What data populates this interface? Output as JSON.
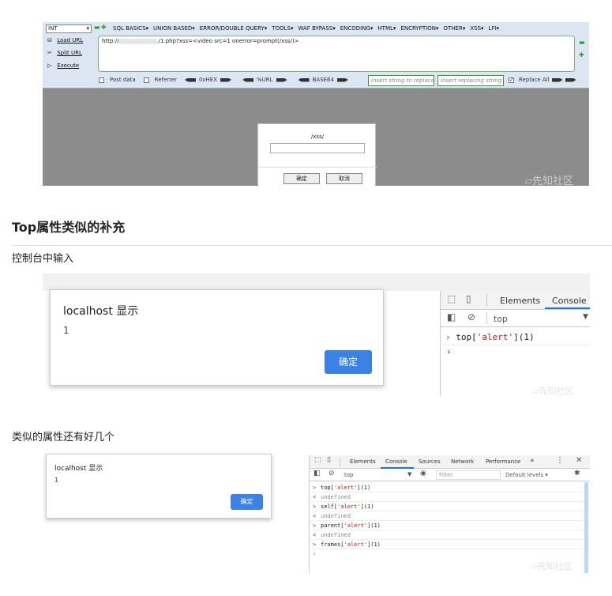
{
  "hackbar": {
    "select_value": "INT",
    "menu": [
      "SQL BASICS▾",
      "UNION BASED▾",
      "ERROR/DOUBLE QUERY▾",
      "TOOLS▾",
      "WAF BYPASS▾",
      "ENCODING▾",
      "HTML▾",
      "ENCRYPTION▾",
      "OTHER▾",
      "XSS▾",
      "LFI▾"
    ],
    "load_url": "Load URL",
    "split_url": "Split URL",
    "execute": "Execute",
    "url_prefix": "http://",
    "url_rest": "./1.php?xss=<video src=1 onerror=prompt(/xss/)>",
    "post_data": "Post data",
    "referrer": "Referrer",
    "hex": "0xHEX",
    "url_enc": "%URL",
    "base64": "BASE64",
    "insert_placeholder": "Insert string to replace",
    "replacing_placeholder": "Insert replacing string",
    "replace_all": "Replace All",
    "prompt_text": "/xss/",
    "ok": "确定",
    "cancel": "取消",
    "watermark": "先知社区"
  },
  "heading": "Top属性类似的补充",
  "para1": "控制台中输入",
  "shot2": {
    "alert_title": "localhost 显示",
    "alert_msg": "1",
    "ok": "确定",
    "tab_elements": "Elements",
    "tab_console": "Console",
    "context": "top",
    "prompt_code_a": "top[",
    "prompt_code_b": "'alert'",
    "prompt_code_c": "](1)",
    "watermark": "先知社区"
  },
  "para2": "类似的属性还有好几个",
  "shot3": {
    "alert_title": "localhost 显示",
    "alert_msg": "1",
    "ok": "确定",
    "tabs": [
      "Elements",
      "Console",
      "Sources",
      "Network",
      "Performance",
      "»"
    ],
    "context": "top",
    "filter": "Filter",
    "levels": "Default levels ▾",
    "lines": [
      {
        "p": ">",
        "a": "top[",
        "s": "'alert'",
        "b": "](1)"
      },
      {
        "p": "<",
        "u": "undefined"
      },
      {
        "p": ">",
        "a": "self[",
        "s": "'alert'",
        "b": "](1)"
      },
      {
        "p": "<",
        "u": "undefined"
      },
      {
        "p": ">",
        "a": "parent[",
        "s": "'alert'",
        "b": "](1)"
      },
      {
        "p": "<",
        "u": "undefined"
      },
      {
        "p": ">",
        "a": "frames[",
        "s": "'alert'",
        "b": "](1)"
      }
    ],
    "watermark": "先知社区"
  }
}
